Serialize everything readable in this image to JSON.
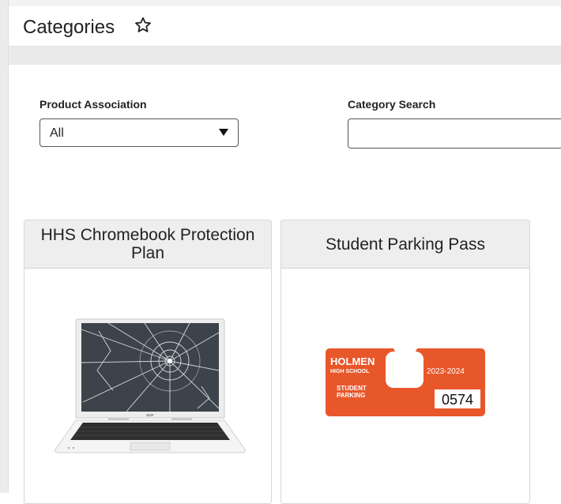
{
  "header": {
    "title": "Categories",
    "favorite_icon": "star-outline-icon"
  },
  "filters": {
    "product_association": {
      "label": "Product Association",
      "selected": "All"
    },
    "category_search": {
      "label": "Category Search",
      "value": "",
      "placeholder": ""
    }
  },
  "categories": [
    {
      "title": "HHS Chromebook Protection Plan",
      "image": "cracked-laptop-image",
      "laptop_brand": "acer"
    },
    {
      "title": "Student Parking Pass",
      "image": "parking-pass-image",
      "pass": {
        "school_line1": "HOLMEN",
        "school_line2": "HIGH SCHOOL",
        "year": "2023-2024",
        "type_line1": "STUDENT",
        "type_line2": "PARKING",
        "number": "0574",
        "color": "#e8572a"
      }
    }
  ]
}
